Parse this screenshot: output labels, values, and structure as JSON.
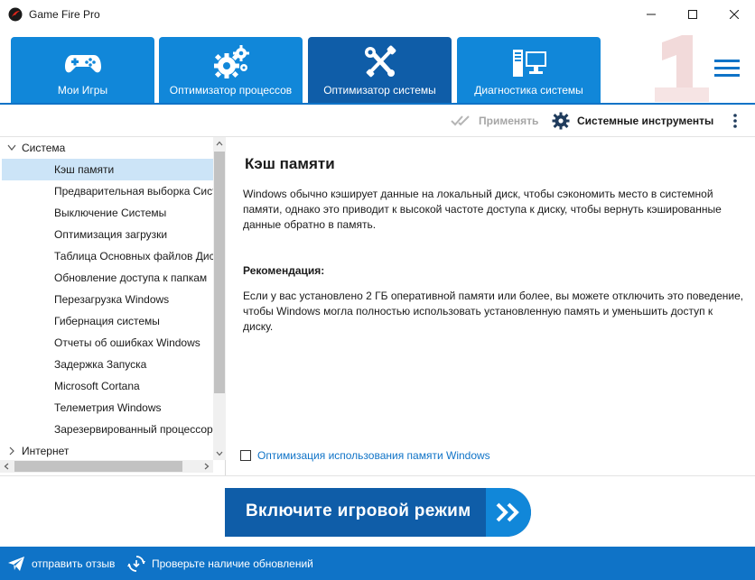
{
  "window": {
    "title": "Game Fire Pro",
    "minimize_glyph": "–",
    "maximize_glyph": "□",
    "close_glyph": "✕"
  },
  "tabs": [
    {
      "label": "Мои Игры",
      "icon": "gamepad-icon",
      "active": false
    },
    {
      "label": "Оптимизатор процессов",
      "icon": "gears-icon",
      "active": false
    },
    {
      "label": "Оптимизатор системы",
      "icon": "tools-icon",
      "active": true
    },
    {
      "label": "Диагностика системы",
      "icon": "computer-icon",
      "active": false
    }
  ],
  "toolbar": {
    "apply_label": "Применять",
    "tools_label": "Системные инструменты"
  },
  "tree": {
    "categories": [
      {
        "label": "Система",
        "expanded": true
      },
      {
        "label": "Интернет",
        "expanded": false
      }
    ],
    "items": [
      "Кэш памяти",
      "Предварительная выборка Сист",
      "Выключение Системы",
      "Оптимизация загрузки",
      "Таблица Основных файлов Дис",
      "Обновление доступа к папкам",
      "Перезагрузка Windows",
      "Гибернация системы",
      "Отчеты об ошибках Windows",
      "Задержка Запуска",
      "Microsoft Cortana",
      "Телеметрия Windows",
      "Зарезервированный процессор"
    ],
    "selected_index": 0
  },
  "content": {
    "title": "Кэш памяти",
    "description": "Windows обычно кэширует данные на локальный диск, чтобы сэкономить место в системной памяти, однако это приводит к высокой частоте доступа к диску, чтобы вернуть кэшированные данные обратно в память.",
    "recommendation_heading": "Рекомендация:",
    "recommendation_text": "Если у вас установлено 2 ГБ оперативной памяти или более, вы можете отключить это поведение, чтобы Windows могла полностью использовать установленную память и уменьшить доступ к диску.",
    "option_label": "Оптимизация использования памяти Windows",
    "option_checked": false
  },
  "game_mode": {
    "label": "Включите игровой режим"
  },
  "footer": {
    "feedback_label": "отправить отзыв",
    "updates_label": "Проверьте наличие обновлений"
  },
  "colors": {
    "tab_blue": "#1187d9",
    "tab_active": "#0f5da8",
    "footer_blue": "#0f73c7",
    "selection": "#cce4f7",
    "link_blue": "#0f73c7"
  }
}
